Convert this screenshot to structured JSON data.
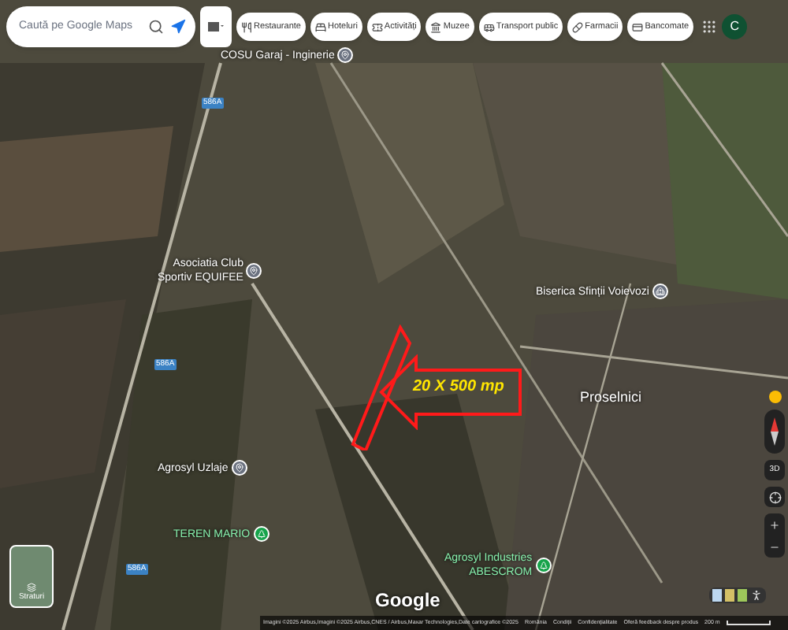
{
  "search": {
    "placeholder": "Caută pe Google Maps"
  },
  "chips": [
    {
      "label": "Restaurante",
      "kind": "fork"
    },
    {
      "label": "Hoteluri",
      "kind": "bed"
    },
    {
      "label": "Activități",
      "kind": "ticket"
    },
    {
      "label": "Muzee",
      "kind": "museum"
    },
    {
      "label": "Transport public",
      "kind": "bus"
    },
    {
      "label": "Farmacii",
      "kind": "pharmacy"
    },
    {
      "label": "Bancomate",
      "kind": "atm"
    }
  ],
  "account": {
    "initial": "C"
  },
  "places": [
    {
      "lines": [
        "COSU Garaj - Inginerie"
      ],
      "kind": "place"
    },
    {
      "lines": [
        "Asociatia Club",
        "Sportiv EQUIFEE"
      ],
      "kind": "place"
    },
    {
      "lines": [
        "Biserica Sfinții Voievozi"
      ],
      "kind": "church"
    },
    {
      "lines": [
        "Proselnici"
      ],
      "kind": "locality"
    },
    {
      "lines": [
        "Agrosyl Uzlaje"
      ],
      "kind": "place"
    },
    {
      "lines": [
        "TEREN MARIO"
      ],
      "kind": "park"
    },
    {
      "lines": [
        "Agrosyl Industries",
        "ABESCROM"
      ],
      "kind": "park"
    }
  ],
  "road_badges": [
    "586A",
    "586A",
    "586A"
  ],
  "annotation": {
    "text": "20 X 500 mp"
  },
  "layers": {
    "label": "Straturi"
  },
  "zoom_level": {
    "label": "3D"
  },
  "logo": "Google",
  "footer": {
    "attribution": "Imagini ©2025 Airbus,Imagini ©2025 Airbus,CNES / Airbus,Maxar Technologies,Date cartografice ©2025",
    "links": [
      "România",
      "Condiții",
      "Confidențialitate",
      "Oferă feedback despre produs"
    ],
    "scale": "200 m"
  }
}
